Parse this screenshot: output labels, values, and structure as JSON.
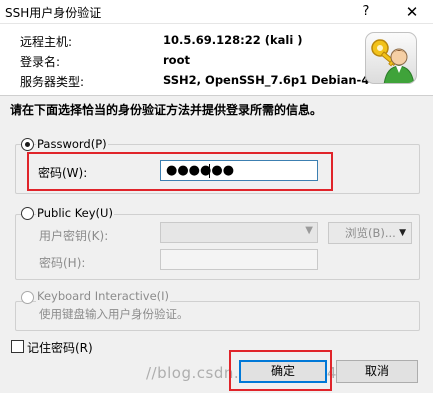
{
  "window": {
    "title": "SSH用户身份验证",
    "help_glyph": "?",
    "close_glyph": "✕"
  },
  "info": {
    "rows": [
      {
        "label": "远程主机:",
        "value": "10.5.69.128:22 (kali )"
      },
      {
        "label": "登录名:",
        "value": "root"
      },
      {
        "label": "服务器类型:",
        "value": "SSH2, OpenSSH_7.6p1 Debian-4"
      }
    ],
    "icon": "key-user-icon"
  },
  "instruction": "请在下面选择恰当的身份验证方法并提供登录所需的信息。",
  "password_method": {
    "label": "Password(P)",
    "selected": true,
    "field_label": "密码(W):",
    "value_masked": "●●●●●●"
  },
  "public_key_method": {
    "label": "Public Key(U)",
    "selected": false,
    "user_key_label": "用户密钥(K):",
    "browse_label": "浏览(B)...",
    "passphrase_label": "密码(H):"
  },
  "keyboard_interactive": {
    "label": "Keyboard Interactive(I)",
    "selected": false,
    "description": "使用键盘输入用户身份验证。"
  },
  "remember_password": {
    "label": "记住密码(R)",
    "checked": false
  },
  "buttons": {
    "ok": "确定",
    "cancel": "取消"
  },
  "watermark": "//blog.csdn.net/qq_34_4097",
  "colors": {
    "highlight": "#e0242a",
    "focus_border": "#0078d7"
  }
}
